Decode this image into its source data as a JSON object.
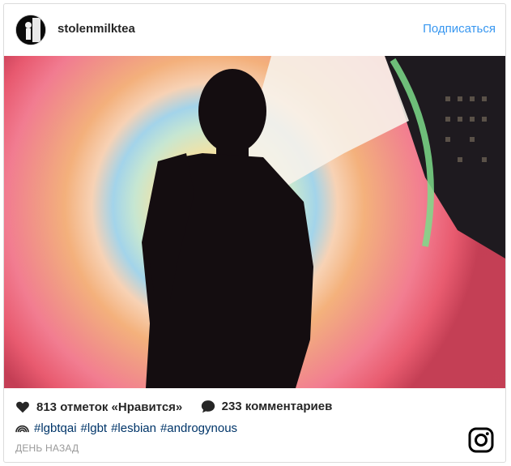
{
  "post": {
    "username": "stolenmilktea",
    "follow_label": "Подписаться",
    "likes_text": "813 отметок «Нравится»",
    "comments_text": "233 комментариев",
    "hashtags": [
      "#lgbtqai",
      "#lgbt",
      "#lesbian",
      "#androgynous"
    ],
    "time_ago": "ДЕНЬ НАЗАД"
  },
  "icons": {
    "like": "heart-icon",
    "comment": "comment-bubble-icon",
    "caption_emoji": "rainbow-icon",
    "brand": "instagram-logo-icon"
  },
  "colors": {
    "link_blue": "#3897f0",
    "hashtag_blue": "#003569",
    "muted_gray": "#999999",
    "text": "#262626"
  }
}
